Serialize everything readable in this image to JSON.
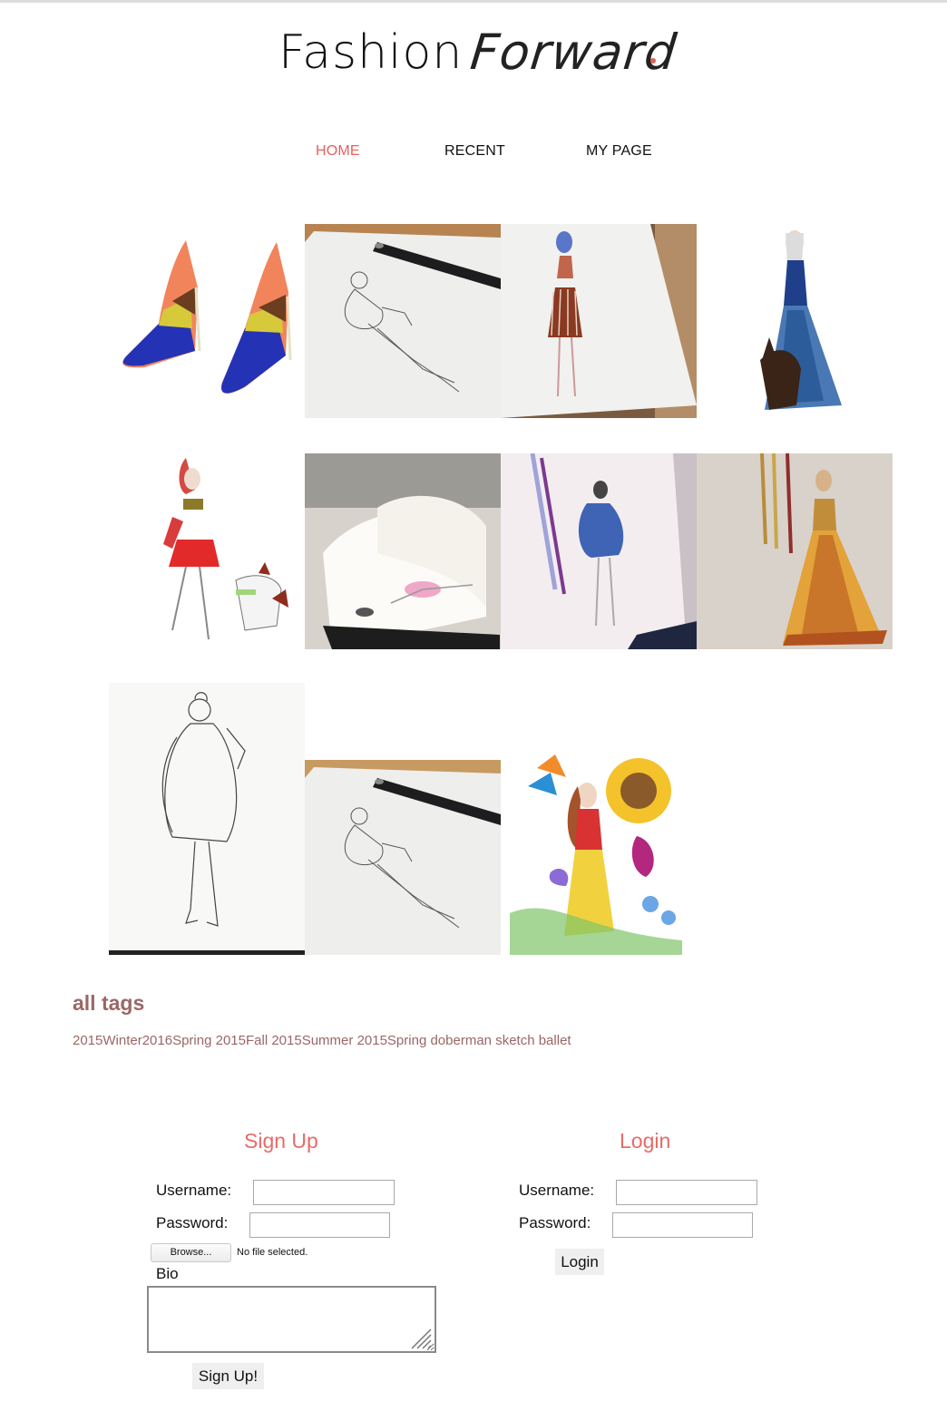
{
  "header": {
    "logo_part1": "Fashion",
    "logo_part2": "Forward",
    "accent_color": "#e85f5c"
  },
  "nav": {
    "items": [
      {
        "label": "HOME",
        "active": true
      },
      {
        "label": "RECENT",
        "active": false
      },
      {
        "label": "MY PAGE",
        "active": false
      }
    ]
  },
  "gallery": {
    "images": [
      {
        "subject": "orange and blue pointed heels"
      },
      {
        "subject": "pencil sketch on notebook with pen"
      },
      {
        "subject": "girl in striped skirt sketch"
      },
      {
        "subject": "blue gown with doberman"
      },
      {
        "subject": "girl in red skirt with dog"
      },
      {
        "subject": "ballet dancer in open sketchbook"
      },
      {
        "subject": "blue fur coat sketch with pencils"
      },
      {
        "subject": "yellow gown with pencils"
      },
      {
        "subject": "ink sketch of girl in fur coat"
      },
      {
        "subject": "pencil sketch on notebook with pen"
      },
      {
        "subject": "girl among sunflower and tropical flowers"
      }
    ]
  },
  "tags": {
    "title": "all tags",
    "items": [
      "2015Winter",
      "2016Spring",
      "2015Fall",
      "2015Summer",
      "2015Spring",
      "doberman",
      "sketch",
      "ballet"
    ]
  },
  "signup": {
    "title": "Sign Up",
    "username_label": "Username:",
    "password_label": "Password:",
    "browse_label": "Browse...",
    "no_file_text": "No file selected.",
    "bio_label": "Bio",
    "submit_label": "Sign Up!"
  },
  "login": {
    "title": "Login",
    "username_label": "Username:",
    "password_label": "Password:",
    "submit_label": "Login"
  },
  "colors": {
    "tag_color": "#9a6766",
    "form_title_color": "#e86a66"
  }
}
